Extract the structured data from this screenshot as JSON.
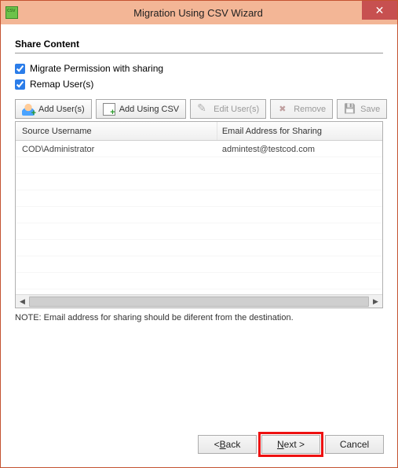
{
  "window": {
    "title": "Migration Using CSV Wizard"
  },
  "section_title": "Share Content",
  "checkboxes": {
    "migrate_permission": {
      "label": "Migrate Permission with sharing",
      "checked": true
    },
    "remap_users": {
      "label": "Remap User(s)",
      "checked": true
    }
  },
  "toolbar": {
    "add_users": "Add User(s)",
    "add_csv": "Add Using CSV",
    "edit_users": "Edit User(s)",
    "remove": "Remove",
    "save": "Save"
  },
  "table": {
    "headers": {
      "source": "Source Username",
      "email": "Email Address for Sharing"
    },
    "rows": [
      {
        "source": "COD\\Administrator",
        "email": "admintest@testcod.com"
      }
    ]
  },
  "note": "NOTE: Email address for sharing should be diferent from the destination.",
  "footer": {
    "back_prefix": "< ",
    "back_u": "B",
    "back_rest": "ack",
    "next_u": "N",
    "next_rest": "ext >",
    "cancel": "Cancel"
  }
}
